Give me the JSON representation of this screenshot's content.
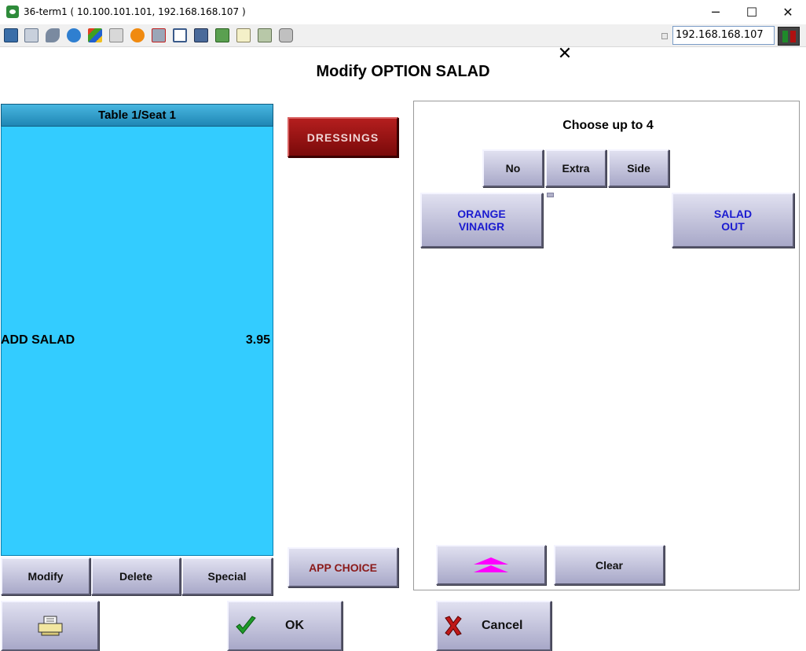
{
  "window": {
    "title": "36-term1 ( 10.100.101.101, 192.168.168.107 )",
    "minimize_glyph": "─",
    "maximize_glyph": "☐",
    "close_glyph": "✕"
  },
  "toolbar": {
    "icons": [
      "monitor-icon",
      "windows-icon",
      "tools-icon",
      "refresh-icon",
      "windows-logo-icon",
      "keyboard-icon",
      "alert-icon",
      "network-icon",
      "fullscreen-icon",
      "display-icon",
      "transfer-icon",
      "note-icon",
      "map-icon",
      "chat-icon"
    ],
    "ip_address": "192.168.168.107"
  },
  "screen": {
    "title": "Modify OPTION SALAD",
    "close_glyph": "✕"
  },
  "order": {
    "header": "Table 1/Seat 1",
    "items": [
      {
        "name": "ADD SALAD",
        "price": "3.95"
      }
    ],
    "buttons": {
      "modify": "Modify",
      "delete": "Delete",
      "special": "Special"
    }
  },
  "categories": {
    "dressings": "DRESSINGS",
    "app_choice": "APP CHOICE"
  },
  "modifiers": {
    "choose_label": "Choose up to 4",
    "qualifiers": {
      "no": "No",
      "extra": "Extra",
      "side": "Side"
    },
    "options": [
      {
        "line1": "ORANGE",
        "line2": "VINAIGR"
      },
      {
        "line1": "SALAD",
        "line2": "OUT"
      }
    ],
    "clear": "Clear"
  },
  "footer": {
    "ok": "OK",
    "cancel": "Cancel"
  },
  "colors": {
    "order_list_bg": "#33ccff",
    "dressings_bg": "#9a1414",
    "scroll_arrow": "#ff00ff"
  }
}
